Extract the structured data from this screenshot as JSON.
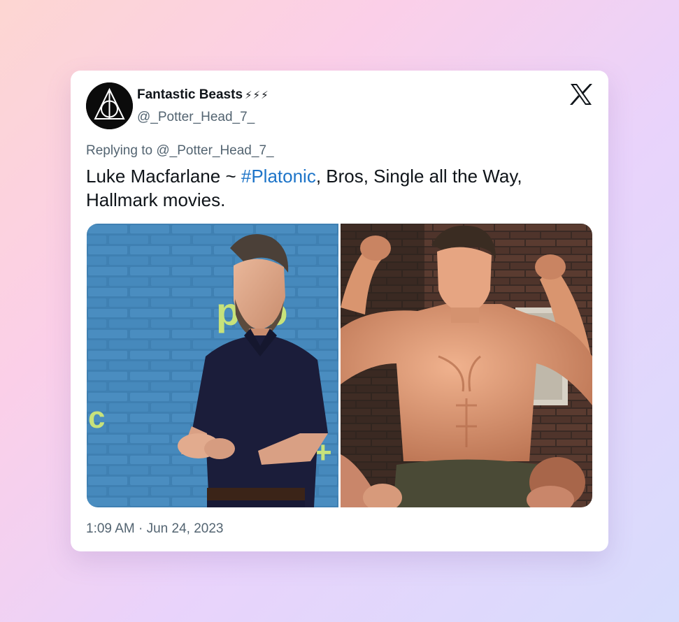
{
  "tweet": {
    "author": {
      "display_name": "Fantastic Beasts",
      "name_emoji": "⚡⚡⚡",
      "handle": "@_Potter_Head_7_",
      "avatar_icon": "deathly-hallows-icon"
    },
    "reply_prefix": "Replying to",
    "reply_handle": "@_Potter_Head_7_",
    "text_before": "Luke Macfarlane ~ ",
    "hashtag": "#Platonic",
    "text_after": ", Bros, Single all the Way, Hallmark movies.",
    "timestamp": "1:09 AM · Jun 24, 2023",
    "brand_icon": "x-logo-icon",
    "media": [
      {
        "type": "photo",
        "wall_letters": "pito",
        "wall_letter_left": "c",
        "wall_letter_right": "+"
      },
      {
        "type": "photo"
      }
    ]
  },
  "colors": {
    "accent": "#1d74c8",
    "text_primary": "#0f1419",
    "text_secondary": "#536471",
    "card_bg": "#ffffff"
  }
}
